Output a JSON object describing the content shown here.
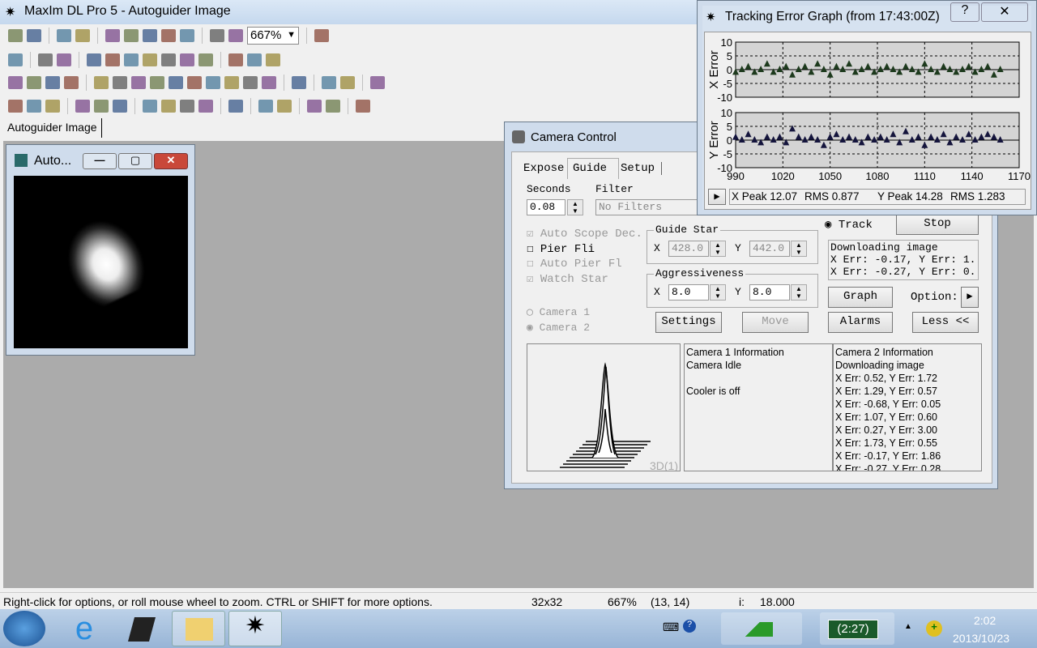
{
  "app": {
    "title": "MaxIm DL Pro 5 - Autoguider Image",
    "icon": "telescope-icon"
  },
  "toolbars": [
    [
      "open-folder",
      "save-disk",
      "sep",
      "undo",
      "redo",
      "sep",
      "properties",
      "stack",
      "zoom-tool",
      "full-screen",
      "grid",
      "sep",
      "mouse",
      "histogram",
      "zoom-select",
      "sep",
      "context-help"
    ],
    [
      "layers",
      "sep",
      "chart-doc",
      "ruler-tool",
      "sep",
      "play-color",
      "swap-color",
      "blocks",
      "balance",
      "color-bar",
      "color-blocks",
      "edit-pen",
      "sep",
      "gray-tool",
      "gray-block",
      "flat-tool"
    ],
    [
      "camera-control",
      "mouse",
      "histogram",
      "crosshair",
      "sep",
      "zoom-tool",
      "full-screen",
      "properties",
      "stack",
      "curve",
      "duplicate",
      "grid",
      "telescope-view",
      "pixels",
      "red-moon",
      "sep",
      "observatory",
      "sep",
      "wand",
      "planner",
      "sep",
      "ruler"
    ],
    [
      "new-doc",
      "open-folder",
      "open-recent",
      "sep",
      "open-file",
      "open-multiple",
      "convert",
      "sep",
      "save-disk",
      "save-as",
      "save-all",
      "batch-save",
      "sep",
      "rotate",
      "sep",
      "print-preview",
      "print",
      "sep",
      "export",
      "export-save",
      "sep",
      "runner"
    ]
  ],
  "zoom": {
    "value": "667%"
  },
  "doc_tab": "Autoguider Image",
  "auto_window": {
    "title": "Auto...",
    "buttons": [
      "minimize",
      "maximize",
      "close"
    ]
  },
  "camera_control": {
    "title": "Camera Control",
    "tabs": [
      "Expose",
      "Guide",
      "Setup"
    ],
    "active_tab": "Guide",
    "seconds_label": "Seconds",
    "seconds": "0.08",
    "filter_label": "Filter",
    "filter": "No Filters",
    "checks": [
      {
        "label": "Auto Scope Dec.",
        "checked": true,
        "enabled": false
      },
      {
        "label": "Pier Fli",
        "checked": false,
        "enabled": true
      },
      {
        "label": "Auto Pier Fl",
        "checked": false,
        "enabled": false
      },
      {
        "label": "Watch Star",
        "checked": true,
        "enabled": false
      }
    ],
    "guide_star": {
      "label": "Guide Star",
      "x_label": "X",
      "x": "428.0",
      "y_label": "Y",
      "y": "442.0"
    },
    "aggressiveness": {
      "label": "Aggressiveness",
      "x_label": "X",
      "x": "8.0",
      "y_label": "Y",
      "y": "8.0"
    },
    "cameras": [
      {
        "label": "Camera 1",
        "selected": false
      },
      {
        "label": "Camera 2",
        "selected": true
      }
    ],
    "track_label": "Track",
    "stop": "Stop",
    "log": [
      "Downloading image",
      "X Err: -0.17, Y Err: 1.",
      "X Err: -0.27, Y Err: 0."
    ],
    "graph": "Graph",
    "options": "Option:",
    "settings": "Settings",
    "move": "Move",
    "alarms": "Alarms",
    "less": "Less <<",
    "plot_label": "3D(1)",
    "cam1": [
      "Camera 1 Information",
      "Camera Idle",
      "",
      "Cooler is off"
    ],
    "cam2": [
      "Camera 2 Information",
      "Downloading image",
      "X Err: 0.52, Y Err: 1.72",
      "X Err: 1.29, Y Err: 0.57",
      "X Err: -0.68, Y Err: 0.05",
      "X Err: 1.07, Y Err: 0.60",
      "X Err: 0.27, Y Err: 3.00",
      "X Err: 1.73, Y Err: 0.55",
      "X Err: -0.17, Y Err: 1.86",
      "X Err: -0.27, Y Err: 0.28"
    ]
  },
  "graph_window": {
    "title": "Tracking Error Graph (from 17:43:00Z)",
    "help": "?",
    "stats": {
      "xpeak": "X Peak 12.07",
      "xrms": "RMS 0.877",
      "ypeak": "Y Peak 14.28",
      "yrms": "RMS 1.283"
    }
  },
  "chart_data": [
    {
      "type": "scatter",
      "ylabel": "X Error",
      "ylim": [
        -10,
        10
      ],
      "xlim": [
        990,
        1170
      ],
      "yticks": [
        "10",
        "5",
        "0",
        "-5",
        "-10"
      ],
      "grid": true,
      "color": "#1d3a1d",
      "x": [
        990,
        994,
        998,
        1002,
        1006,
        1010,
        1014,
        1018,
        1022,
        1026,
        1030,
        1034,
        1038,
        1042,
        1046,
        1050,
        1054,
        1058,
        1062,
        1066,
        1070,
        1074,
        1078,
        1082,
        1086,
        1090,
        1094,
        1098,
        1102,
        1106,
        1110,
        1114,
        1118,
        1122,
        1126,
        1130,
        1134,
        1138,
        1142,
        1146,
        1150,
        1154,
        1158
      ],
      "y": [
        -1,
        0,
        1,
        -1,
        0,
        2,
        -1,
        0,
        1,
        -2,
        0,
        1,
        -1,
        2,
        0,
        -2,
        1,
        0,
        2,
        -1,
        0,
        1,
        -1,
        0,
        1,
        0,
        -1,
        1,
        0,
        -1,
        2,
        0,
        -1,
        1,
        0,
        -1,
        0,
        1,
        -1,
        0,
        1,
        -2,
        0
      ]
    },
    {
      "type": "scatter",
      "ylabel": "Y Error",
      "ylim": [
        -10,
        10
      ],
      "xlim": [
        990,
        1170
      ],
      "yticks": [
        "10",
        "5",
        "0",
        "-5",
        "-10"
      ],
      "xticks": [
        "990",
        "1020",
        "1050",
        "1080",
        "1110",
        "1140",
        "1170"
      ],
      "grid": true,
      "color": "#14143c",
      "x": [
        990,
        994,
        998,
        1002,
        1006,
        1010,
        1014,
        1018,
        1022,
        1026,
        1030,
        1034,
        1038,
        1042,
        1046,
        1050,
        1054,
        1058,
        1062,
        1066,
        1070,
        1074,
        1078,
        1082,
        1086,
        1090,
        1094,
        1098,
        1102,
        1106,
        1110,
        1114,
        1118,
        1122,
        1126,
        1130,
        1134,
        1138,
        1142,
        1146,
        1150,
        1154,
        1158
      ],
      "y": [
        1,
        0,
        2,
        0,
        -1,
        1,
        0,
        1,
        -1,
        4,
        1,
        0,
        1,
        0,
        -2,
        1,
        2,
        0,
        1,
        0,
        -1,
        1,
        0,
        1,
        0,
        2,
        -1,
        3,
        0,
        1,
        -2,
        1,
        0,
        2,
        -1,
        1,
        0,
        2,
        0,
        1,
        2,
        1,
        0
      ]
    }
  ],
  "status": {
    "hint": "Right-click for options, or roll mouse wheel to zoom. CTRL or SHIFT for more options.",
    "size": "32x32",
    "zoom": "667%",
    "coords": "(13, 14)",
    "intensity_label": "i:",
    "intensity": "18.000"
  },
  "taskbar": {
    "apps": [
      "start-orb",
      "internet-explorer",
      "laptop-app",
      "file-explorer",
      "maxim-dl"
    ],
    "battery": "(2:27)",
    "time": "2:02",
    "date": "2013/10/23"
  }
}
